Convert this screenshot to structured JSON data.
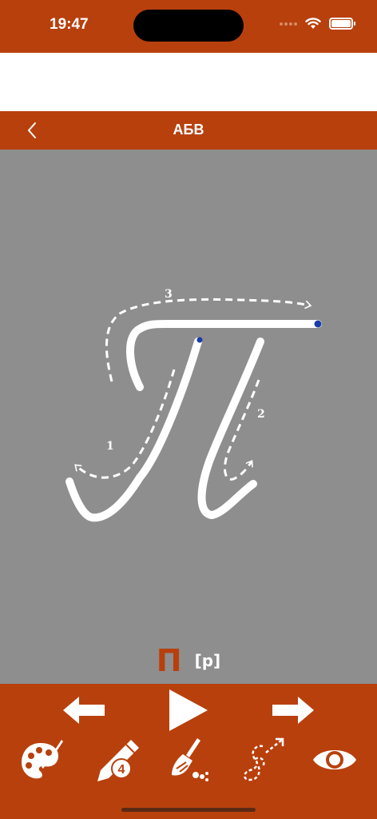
{
  "status_bar": {
    "time": "19:47"
  },
  "nav": {
    "title": "АБВ"
  },
  "canvas": {
    "stroke_numbers": [
      "1",
      "2",
      "3"
    ],
    "letter": "П",
    "phonetic": "[p]"
  },
  "toolbar": {
    "pencil_badge": "4"
  },
  "colors": {
    "accent": "#b8400d",
    "canvas_bg": "#8e8e8e",
    "stroke": "#ffffff",
    "start_dot": "#1a3ca8"
  },
  "icons": {
    "back": "chevron-left-icon",
    "prev": "arrow-left-icon",
    "play": "play-icon",
    "next": "arrow-right-icon",
    "palette": "palette-icon",
    "pencil": "pencil-icon",
    "broom": "broom-icon",
    "trace": "trace-path-icon",
    "eye": "eye-icon"
  }
}
